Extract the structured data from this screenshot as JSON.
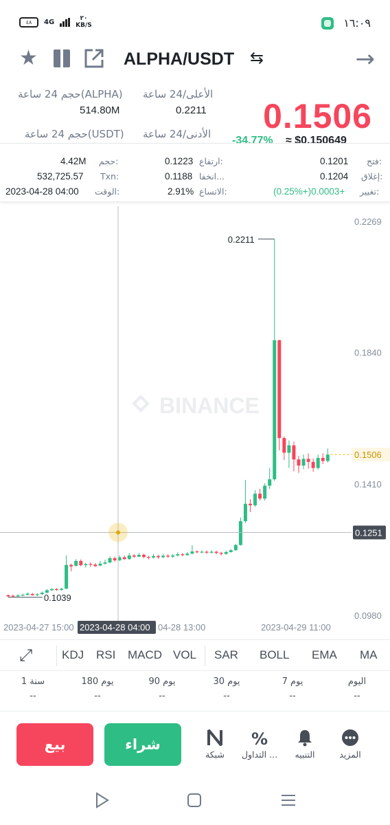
{
  "status_bar": {
    "battery": "٤٨",
    "network": "4G",
    "speed_value": "٢٠",
    "speed_unit": "KB/S",
    "time": "١٦:٠٩"
  },
  "header": {
    "pair": "ALPHA/USDT",
    "icons": [
      "star-icon",
      "book-icon",
      "share-icon",
      "swap-icon",
      "arrow-right-icon"
    ]
  },
  "stats": {
    "high_label": "الأعلى/24 ساعة",
    "high_value": "0.2211",
    "low_label": "الأدنى/24 ساعة",
    "vol_alpha_label": "حجم 24 ساعة(ALPHA)",
    "vol_alpha_value": "514.80M",
    "vol_usdt_label": "حجم 24 ساعة(USDT)",
    "price": "0.1506",
    "peek_change": "-34.77%",
    "peek_price": "≈ $0.150649"
  },
  "candle_info": {
    "open_label": "فتح:",
    "open_value": "0.1201",
    "close_label": "إغلاق:",
    "close_value": "0.1204",
    "change_label": "تغيير:",
    "change_value": "(0.25%+)0.0003+",
    "high_label": "ارتفاع:",
    "high_value": "0.1223",
    "low_label": "انخفا...",
    "low_value": "0.1188",
    "range_label": "الاتساع:",
    "range_value": "2.91%",
    "volume_label": "حجم:",
    "volume_value": "4.42M",
    "txn_label": "Txn:",
    "txn_value": "532,725.57",
    "time_label": "الوقت:",
    "time_value": "2023-04-28 04:00"
  },
  "chart": {
    "watermark": "BINANCE",
    "y_ticks": [
      "0.2269",
      "0.1840",
      "0.1410",
      "0.0980"
    ],
    "current_price_label": "0.1506",
    "crosshair_price_label": "0.1251",
    "max_label": "0.2211",
    "min_label": "0.1039",
    "x_labels": [
      "2023-04-27 15:00",
      "04-28 13:00",
      "2023-04-29 11:00"
    ],
    "crosshair_time_label": "2023-04-28 04:00",
    "colors": {
      "up": "#2ebd85",
      "down": "#f6465d",
      "current": "#f0b90b"
    }
  },
  "chart_data": {
    "type": "candlestick",
    "y_range": [
      0.098,
      0.2269
    ],
    "candles": [
      [
        0.1046,
        0.1042,
        0.1048,
        0.1039
      ],
      [
        0.1044,
        0.1042,
        0.1048,
        0.104
      ],
      [
        0.1042,
        0.1045,
        0.1049,
        0.104
      ],
      [
        0.1045,
        0.1047,
        0.1051,
        0.1043
      ],
      [
        0.1047,
        0.1051,
        0.1055,
        0.1045
      ],
      [
        0.105,
        0.1046,
        0.1053,
        0.1044
      ],
      [
        0.1046,
        0.1049,
        0.1052,
        0.1043
      ],
      [
        0.1049,
        0.1054,
        0.1058,
        0.1047
      ],
      [
        0.1054,
        0.1062,
        0.1066,
        0.1052
      ],
      [
        0.1062,
        0.1066,
        0.1069,
        0.106
      ],
      [
        0.1066,
        0.1063,
        0.1069,
        0.106
      ],
      [
        0.1063,
        0.1067,
        0.107,
        0.1061
      ],
      [
        0.1067,
        0.1145,
        0.1176,
        0.1066
      ],
      [
        0.1145,
        0.114,
        0.1149,
        0.1124
      ],
      [
        0.1142,
        0.1158,
        0.1164,
        0.114
      ],
      [
        0.1158,
        0.1144,
        0.1163,
        0.114
      ],
      [
        0.1144,
        0.1148,
        0.1152,
        0.1136
      ],
      [
        0.1148,
        0.1146,
        0.1153,
        0.1139
      ],
      [
        0.1146,
        0.1141,
        0.1151,
        0.1138
      ],
      [
        0.1143,
        0.1149,
        0.1158,
        0.114
      ],
      [
        0.1149,
        0.1153,
        0.1162,
        0.1146
      ],
      [
        0.1153,
        0.1167,
        0.1173,
        0.115
      ],
      [
        0.1167,
        0.116,
        0.1172,
        0.1155
      ],
      [
        0.116,
        0.117,
        0.1176,
        0.1157
      ],
      [
        0.117,
        0.1164,
        0.1175,
        0.1161
      ],
      [
        0.1164,
        0.1176,
        0.1184,
        0.1162
      ],
      [
        0.1176,
        0.1172,
        0.118,
        0.1168
      ],
      [
        0.1172,
        0.1178,
        0.1184,
        0.117
      ],
      [
        0.1178,
        0.1171,
        0.1182,
        0.1166
      ],
      [
        0.1171,
        0.1169,
        0.1175,
        0.1163
      ],
      [
        0.1169,
        0.1174,
        0.118,
        0.1166
      ],
      [
        0.1174,
        0.117,
        0.1178,
        0.1165
      ],
      [
        0.117,
        0.1175,
        0.1181,
        0.1167
      ],
      [
        0.1175,
        0.1172,
        0.118,
        0.1168
      ],
      [
        0.1172,
        0.1176,
        0.1181,
        0.1168
      ],
      [
        0.1176,
        0.118,
        0.1186,
        0.1172
      ],
      [
        0.118,
        0.1177,
        0.1184,
        0.1173
      ],
      [
        0.1177,
        0.1182,
        0.1187,
        0.1175
      ],
      [
        0.1182,
        0.1189,
        0.1209,
        0.1179
      ],
      [
        0.1189,
        0.1187,
        0.1193,
        0.1183
      ],
      [
        0.1187,
        0.1188,
        0.1193,
        0.1183
      ],
      [
        0.1188,
        0.1185,
        0.1192,
        0.1181
      ],
      [
        0.1185,
        0.1188,
        0.1193,
        0.1182
      ],
      [
        0.1188,
        0.1184,
        0.1191,
        0.118
      ],
      [
        0.1184,
        0.1181,
        0.1188,
        0.1176
      ],
      [
        0.1181,
        0.1187,
        0.1192,
        0.1178
      ],
      [
        0.1187,
        0.1193,
        0.1197,
        0.1185
      ],
      [
        0.1193,
        0.121,
        0.1214,
        0.1191
      ],
      [
        0.121,
        0.1288,
        0.13,
        0.1208
      ],
      [
        0.1288,
        0.1345,
        0.1423,
        0.1282
      ],
      [
        0.1345,
        0.134,
        0.136,
        0.1318
      ],
      [
        0.134,
        0.1378,
        0.139,
        0.1335
      ],
      [
        0.1378,
        0.1362,
        0.1394,
        0.1355
      ],
      [
        0.1362,
        0.1404,
        0.1412,
        0.1355
      ],
      [
        0.1404,
        0.1425,
        0.1462,
        0.1394
      ],
      [
        0.1425,
        0.188,
        0.2211,
        0.142
      ],
      [
        0.188,
        0.156,
        0.1882,
        0.152
      ],
      [
        0.156,
        0.1512,
        0.1565,
        0.1488
      ],
      [
        0.1512,
        0.1536,
        0.1552,
        0.1462
      ],
      [
        0.1536,
        0.149,
        0.1548,
        0.1451
      ],
      [
        0.149,
        0.147,
        0.1502,
        0.1446
      ],
      [
        0.147,
        0.1492,
        0.1506,
        0.1458
      ],
      [
        0.1492,
        0.1482,
        0.151,
        0.146
      ],
      [
        0.1482,
        0.1462,
        0.1493,
        0.145
      ],
      [
        0.1462,
        0.1495,
        0.1506,
        0.1457
      ],
      [
        0.1495,
        0.1485,
        0.151,
        0.1475
      ],
      [
        0.1485,
        0.1506,
        0.1526,
        0.148
      ]
    ]
  },
  "indicators": [
    "KDJ",
    "RSI",
    "MACD",
    "VOL",
    "SAR",
    "BOLL",
    "EMA",
    "MA"
  ],
  "performance": [
    {
      "label": "اليوم",
      "value": "--"
    },
    {
      "label": "7 يوم",
      "value": "--"
    },
    {
      "label": "30 يوم",
      "value": "--"
    },
    {
      "label": "90 يوم",
      "value": "--"
    },
    {
      "label": "180 يوم",
      "value": "--"
    },
    {
      "label": "1 سنة",
      "value": "--"
    }
  ],
  "actions": {
    "sell": "بيع",
    "buy": "شراء",
    "grid": "شبكة",
    "trade": "التداول ...",
    "alert": "التنبيه",
    "more": "المزيد"
  }
}
